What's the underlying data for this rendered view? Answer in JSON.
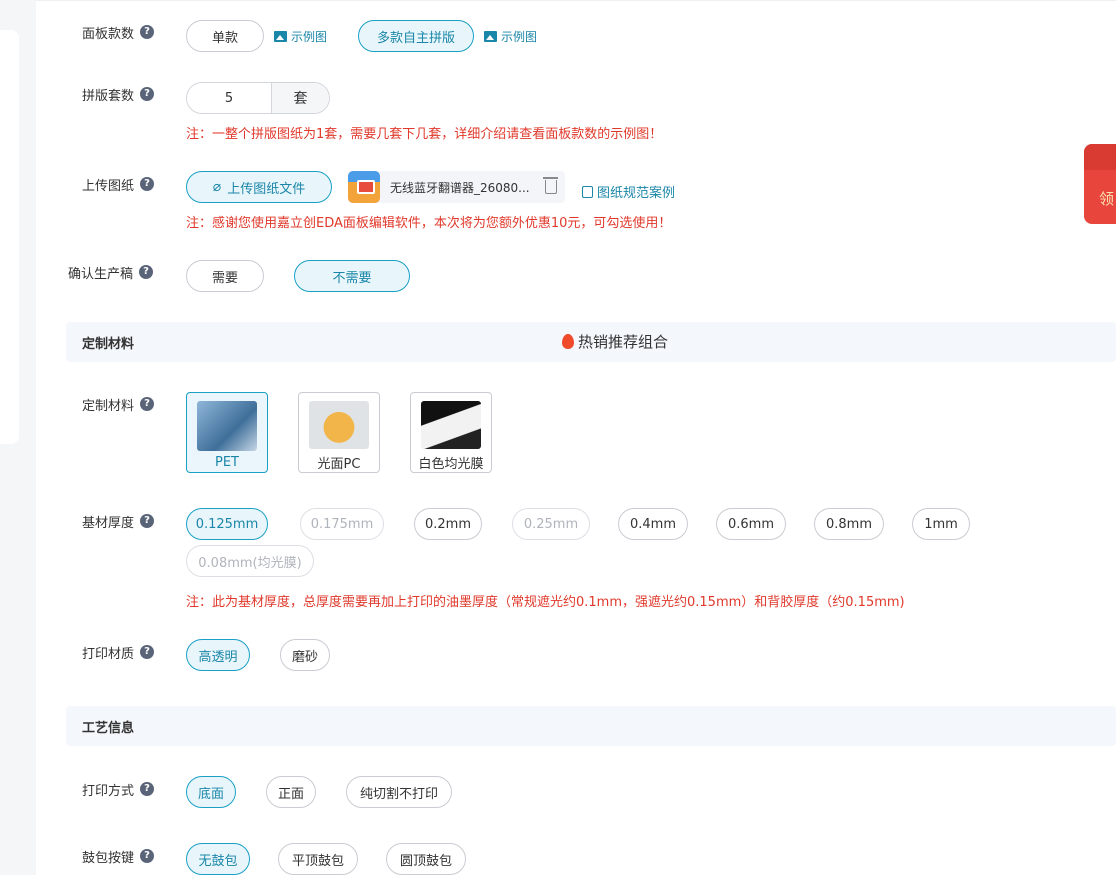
{
  "panel_type": {
    "label": "面板款数",
    "options": [
      "单款",
      "多款自主拼版"
    ],
    "selected": "多款自主拼版",
    "example_link": "示例图"
  },
  "panel_count": {
    "label": "拼版套数",
    "value": "5",
    "unit": "套",
    "note": "注：一整个拼版图纸为1套，需要几套下几套，详细介绍请查看面板款数的示例图！"
  },
  "upload": {
    "label": "上传图纸",
    "button": "上传图纸文件",
    "file_name": "无线蓝牙翻谱器_26080...",
    "spec_link": "图纸规范案例",
    "note": "注：感谢您使用嘉立创EDA面板编辑软件，本次将为您额外优惠10元，可勾选使用！"
  },
  "confirm": {
    "label": "确认生产稿",
    "options": [
      "需要",
      "不需要"
    ],
    "selected": "不需要"
  },
  "section_material": {
    "title": "定制材料",
    "hot": "热销推荐组合"
  },
  "material": {
    "label": "定制材料",
    "options": [
      "PET",
      "光面PC",
      "白色均光膜"
    ],
    "selected": "PET"
  },
  "thickness": {
    "label": "基材厚度",
    "options": [
      "0.125mm",
      "0.175mm",
      "0.2mm",
      "0.25mm",
      "0.4mm",
      "0.6mm",
      "0.8mm",
      "1mm",
      "0.08mm(均光膜)"
    ],
    "selected": "0.125mm",
    "disabled": [
      "0.175mm",
      "0.25mm",
      "0.08mm(均光膜)"
    ],
    "note": "注：此为基材厚度，总厚度需要再加上打印的油墨厚度（常规遮光约0.1mm，强遮光约0.15mm）和背胶厚度（约0.15mm)"
  },
  "print_material": {
    "label": "打印材质",
    "options": [
      "高透明",
      "磨砂"
    ],
    "selected": "高透明"
  },
  "section_process": {
    "title": "工艺信息"
  },
  "print_method": {
    "label": "打印方式",
    "options": [
      "底面",
      "正面",
      "纯切割不打印"
    ],
    "selected": "底面"
  },
  "emboss": {
    "label": "鼓包按键",
    "options": [
      "无鼓包",
      "平顶鼓包",
      "圆顶鼓包"
    ],
    "selected": "无鼓包"
  },
  "coupon": {
    "label": "领"
  },
  "colors": {
    "accent": "#1a86a8",
    "accent_border": "#1aa0c6",
    "note_red": "#e0392b"
  }
}
